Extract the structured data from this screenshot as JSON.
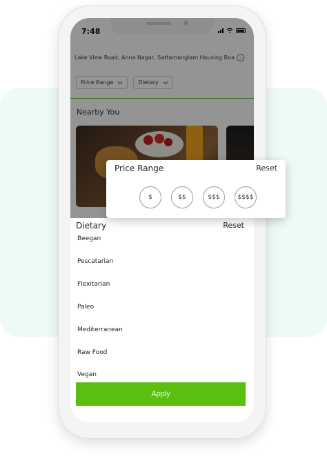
{
  "status_bar": {
    "time": "7:48"
  },
  "location": {
    "address": "Lake View Road, Anna Nagar, Sattamanglam Housing Boa"
  },
  "filters": {
    "price_range_label": "Price Range",
    "dietary_label": "Dietary"
  },
  "nearby": {
    "title": "Nearby You"
  },
  "price_popup": {
    "title": "Price Range",
    "reset_label": "Reset",
    "options": [
      "$",
      "$$",
      "$$$",
      "$$$$"
    ]
  },
  "dietary_sheet": {
    "title": "Dietary",
    "reset_label": "Reset",
    "items": [
      "Beegan",
      "Pescatarian",
      "Flexitarian",
      "Paleo",
      "Mediterranean",
      "Raw Food",
      "Vegan"
    ],
    "apply_label": "Apply"
  },
  "colors": {
    "accent_green": "#5bbf10",
    "mint_background": "#eefaf4"
  }
}
